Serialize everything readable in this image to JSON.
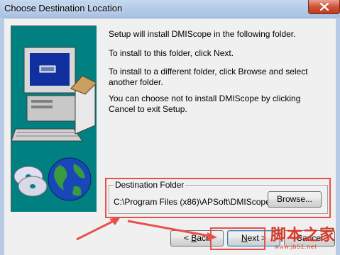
{
  "window": {
    "title": "Choose Destination Location",
    "close_icon": "close-icon"
  },
  "instructions": {
    "line1": "Setup will install DMIScope in the following folder.",
    "line2": "To install to this folder, click Next.",
    "line3": "To install to a different folder, click Browse and select another folder.",
    "line4": "You can choose not to install DMIScope by clicking Cancel to exit Setup."
  },
  "destination": {
    "group_label": "Destination Folder",
    "path": "C:\\Program Files (x86)\\APSoft\\DMIScope",
    "browse_label": "Browse..."
  },
  "buttons": {
    "back_prefix": "< ",
    "back_key": "B",
    "back_rest": "ack",
    "next_key": "N",
    "next_rest": "ext >",
    "cancel_label": "Cancel"
  },
  "watermark": {
    "main": "脚本之家",
    "url": "www.jb51.net"
  },
  "colors": {
    "art_background": "#008080",
    "annotation_red": "#e8504a",
    "title_bar": "#b5cbe8"
  }
}
